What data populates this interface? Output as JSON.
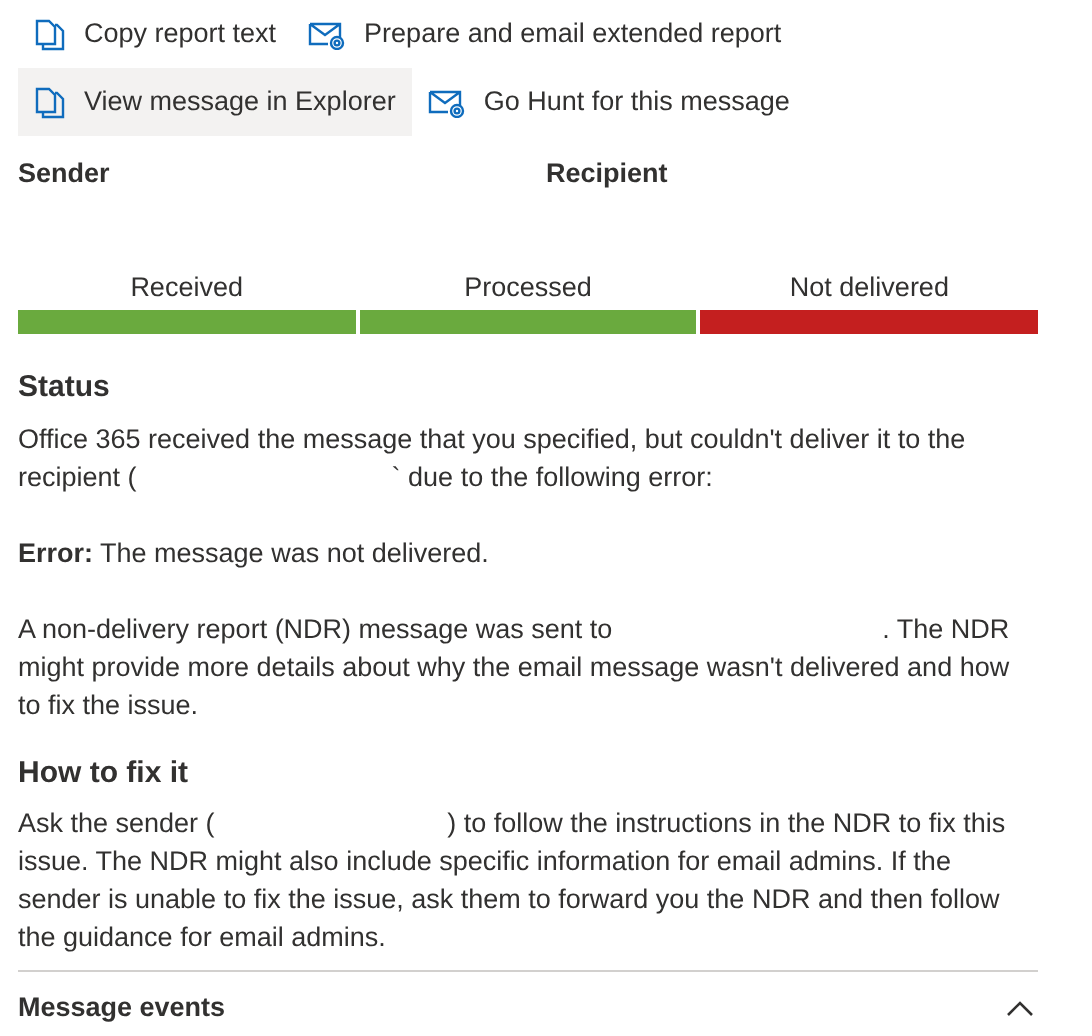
{
  "actions": [
    {
      "label": "Copy report text",
      "kind": "copy",
      "highlighted": false
    },
    {
      "label": "Prepare and email extended report",
      "kind": "mail",
      "highlighted": false
    },
    {
      "label": "View message in Explorer",
      "kind": "copy",
      "highlighted": true
    },
    {
      "label": "Go Hunt for this message",
      "kind": "mail",
      "highlighted": false
    }
  ],
  "parties": [
    {
      "label": "Sender"
    },
    {
      "label": "Recipient"
    }
  ],
  "stages": [
    {
      "label": "Received",
      "color": "#6aaa3e"
    },
    {
      "label": "Processed",
      "color": "#6aaa3e"
    },
    {
      "label": "Not delivered",
      "color": "#c41f1f"
    }
  ],
  "status": {
    "heading": "Status",
    "paragraphs": [
      "Office 365 received the message that you specified, but couldn't deliver it to the recipient (                                  ` due to the following error:",
      "**Error:** The message was not delivered.",
      "A non-delivery report (NDR) message was sent to                                    . The NDR might provide more details about why the email message wasn't delivered and how to fix the issue."
    ]
  },
  "fix": {
    "heading": "How to fix it",
    "paragraphs": [
      "Ask the sender (                               ) to follow the instructions in the NDR to fix this issue. The NDR might also include specific information for email admins. If the sender is unable to fix the issue, ask them to forward you the NDR and then follow the guidance for email admins."
    ]
  },
  "events": {
    "title": "Message events",
    "expanded": true
  }
}
